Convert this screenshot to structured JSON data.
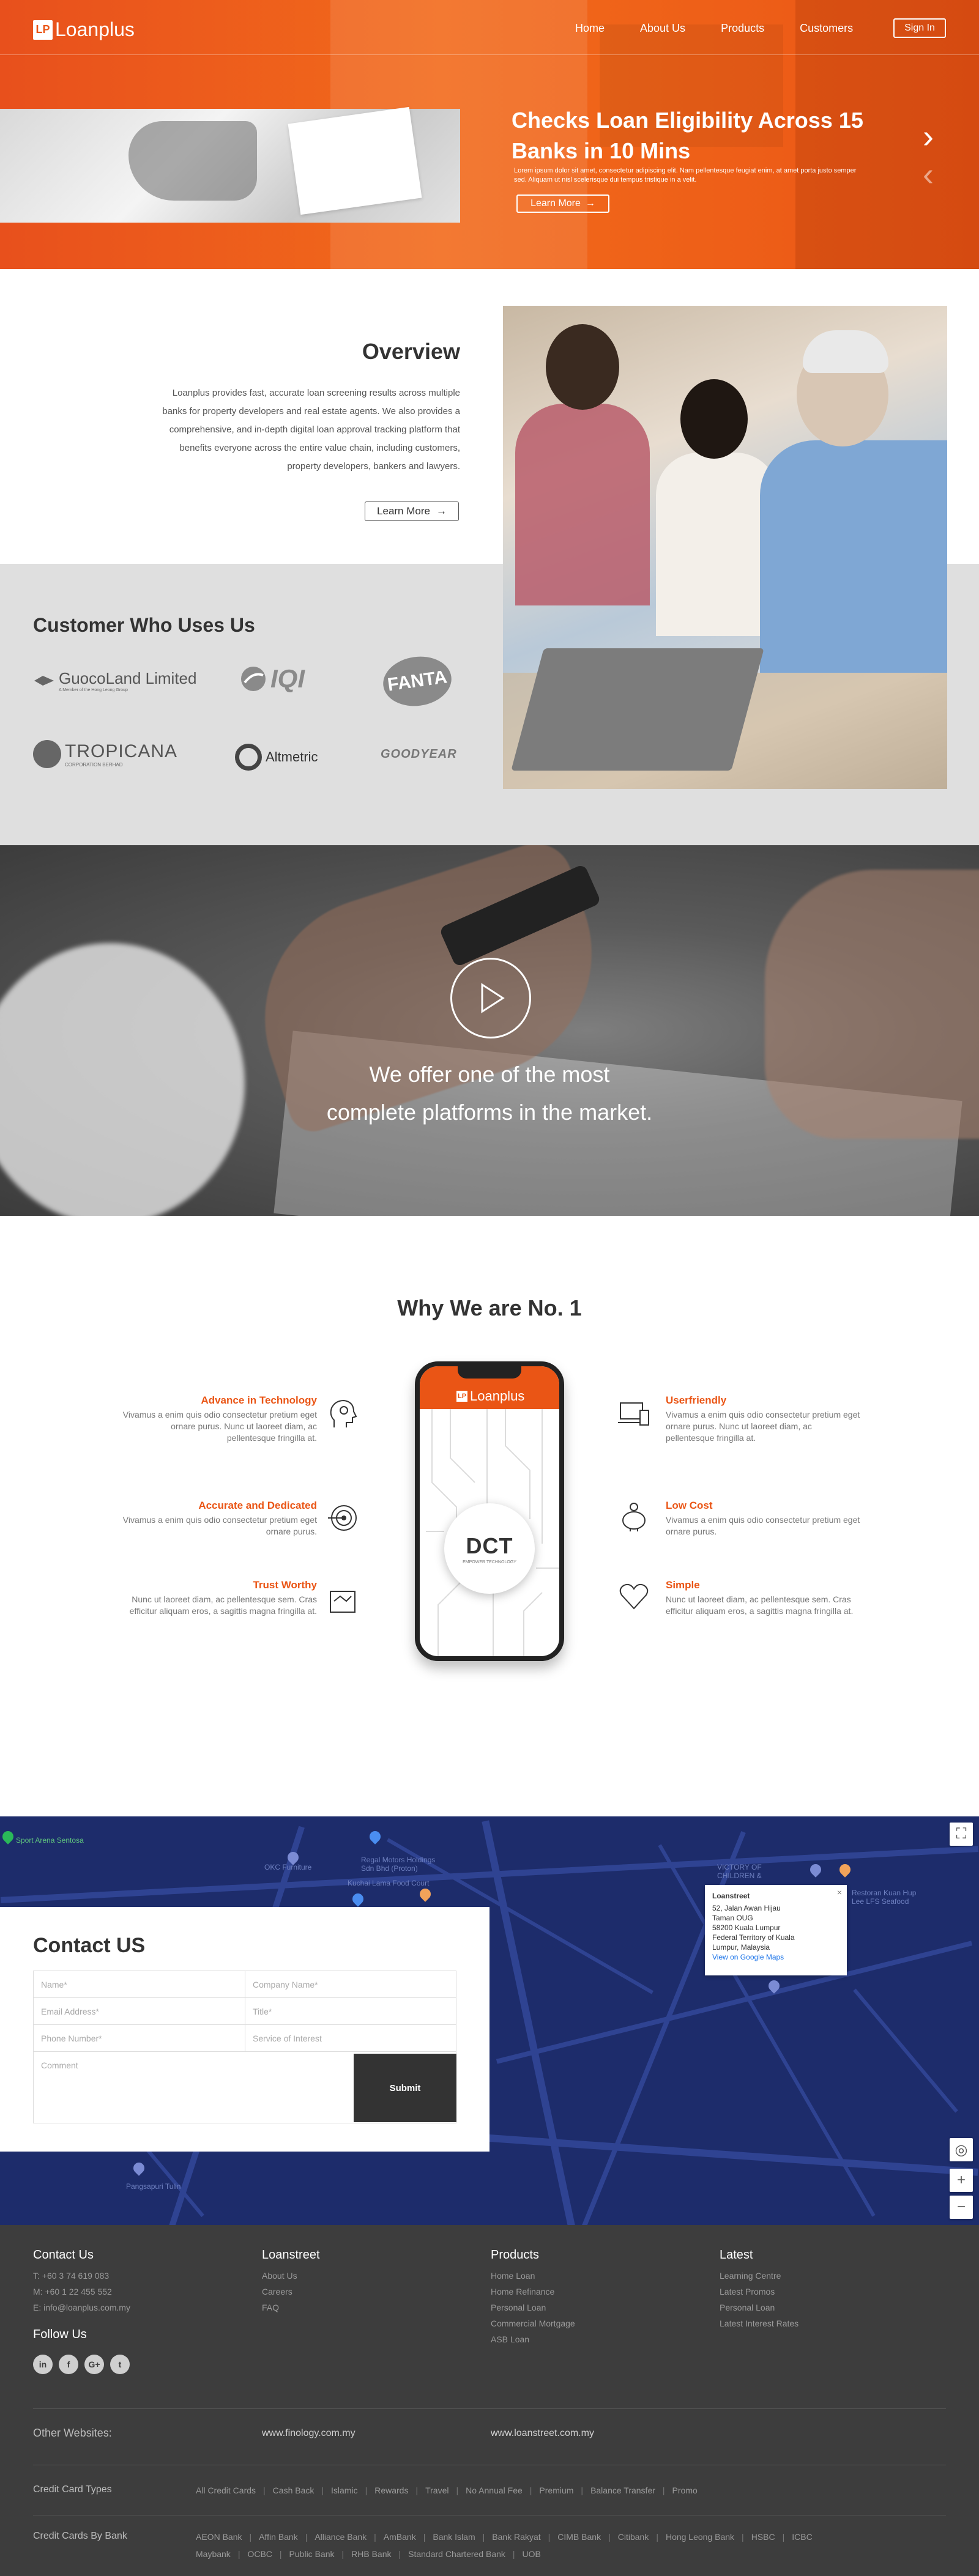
{
  "nav": {
    "logo_mark": "LP",
    "logo_text": "Loanplus",
    "links": [
      "Home",
      "About Us",
      "Products",
      "Customers"
    ],
    "signin": "Sign In"
  },
  "hero": {
    "title": "Checks Loan Eligibility Across 15 Banks in 10 Mins",
    "subtitle": "Lorem ipsum dolor sit amet, consectetur adipiscing elit. Nam pellentesque feugiat enim, at amet porta justo semper sed. Aliquam ut nisl scelerisque dui tempus tristique in a velit.",
    "button": "Learn More",
    "accent": "#ea5515"
  },
  "overview": {
    "title": "Overview",
    "text": "Loanplus provides fast, accurate loan screening results across multiple banks for property developers and real estate agents. We also provides a comprehensive, and in-depth digital loan approval tracking platform that benefits everyone across the entire value chain, including customers, property developers, bankers and lawyers.",
    "button": "Learn More"
  },
  "customers": {
    "title": "Customer Who Uses Us",
    "logos": [
      {
        "name": "GuocoLand Limited",
        "sub": "A Member of the Hong Leong Group"
      },
      {
        "name": "IQI"
      },
      {
        "name": "FANTA"
      },
      {
        "name": "TROPICANA",
        "sub": "CORPORATION BERHAD"
      },
      {
        "name": "Altmetric"
      },
      {
        "name": "GOODYEAR"
      }
    ]
  },
  "video": {
    "line1": "We offer one of  the most",
    "line2": "complete platforms in the market."
  },
  "why": {
    "title": "Why We are No. 1",
    "features": [
      {
        "title": "Advance in Technology",
        "text": "Vivamus a enim quis odio consectetur pretium eget ornare purus. Nunc ut laoreet diam, ac pellentesque fringilla at."
      },
      {
        "title": "Accurate and Dedicated",
        "text": "Vivamus a enim quis odio consectetur pretium eget ornare purus."
      },
      {
        "title": "Trust Worthy",
        "text": "Nunc ut laoreet diam, ac pellentesque sem. Cras efficitur aliquam eros, a sagittis magna fringilla at."
      },
      {
        "title": "Userfriendly",
        "text": "Vivamus a enim quis odio consectetur pretium eget ornare purus. Nunc ut laoreet diam, ac pellentesque fringilla at."
      },
      {
        "title": "Low Cost",
        "text": "Vivamus a enim quis odio consectetur pretium eget ornare purus."
      },
      {
        "title": "Simple",
        "text": "Nunc ut laoreet diam, ac pellentesque sem. Cras efficitur aliquam eros, a sagittis magna fringilla at."
      }
    ],
    "phone_logo": "Loanplus",
    "phone_badge": "DCT",
    "phone_badge_sub": "EMPOWER TECHNOLOGY"
  },
  "map": {
    "labels": [
      "Sport Arena Sentosa",
      "OKC Furniture",
      "Regal Motors Holdings Sdn Bhd (Proton)",
      "Kuchai Lama Food Court",
      "Pangsapuri Tulin",
      "VICTORY OF CHILDREN &",
      "Restoran Kuan Hup Lee LFS Seafood"
    ],
    "popup": {
      "title": "Loanstreet",
      "lines": [
        "52, Jalan Awan Hijau",
        "Taman OUG",
        "58200 Kuala Lumpur",
        "Federal Territory of Kuala",
        "Lumpur, Malaysia"
      ],
      "link": "View on Google Maps"
    }
  },
  "contact": {
    "title": "Contact US",
    "fields": {
      "name": "Name*",
      "company": "Company Name*",
      "email": "Email Address*",
      "title": "Title*",
      "phone": "Phone Number*",
      "service": "Service of Interest",
      "comment": "Comment"
    },
    "submit": "Submit"
  },
  "footer": {
    "contact_title": "Contact Us",
    "contact_lines": [
      "T: +60 3 74 619 083",
      "M: +60 1 22 455 552",
      "E: info@loanplus.com.my"
    ],
    "follow_title": "Follow Us",
    "social": [
      "in",
      "f",
      "G+",
      "t"
    ],
    "loanstreet_title": "Loanstreet",
    "loanstreet_links": [
      "About Us",
      "Careers",
      "FAQ"
    ],
    "products_title": "Products",
    "products_links": [
      "Home Loan",
      "Home Refinance",
      "Personal Loan",
      "Commercial Mortgage",
      "ASB Loan"
    ],
    "latest_title": "Latest",
    "latest_links": [
      "Learning Centre",
      "Latest Promos",
      "Personal Loan",
      "Latest Interest Rates"
    ],
    "other_label": "Other Websites:",
    "other_sites": [
      "www.finology.com.my",
      "www.loanstreet.com.my"
    ],
    "cc_types_label": "Credit Card Types",
    "cc_types": [
      "All Credit Cards",
      "Cash Back",
      "Islamic",
      "Rewards",
      "Travel",
      "No Annual Fee",
      "Premium",
      "Balance Transfer",
      "Promo"
    ],
    "cc_bank_label": "Credit Cards By Bank",
    "cc_banks": [
      "AEON Bank",
      "Affin Bank",
      "Alliance Bank",
      "AmBank",
      "Bank Islam",
      "Bank Rakyat",
      "CIMB Bank",
      "Citibank",
      "Hong Leong Bank",
      "HSBC",
      "ICBC",
      "Maybank",
      "OCBC",
      "Public Bank",
      "RHB Bank",
      "Standard Chartered Bank",
      "UOB"
    ]
  }
}
